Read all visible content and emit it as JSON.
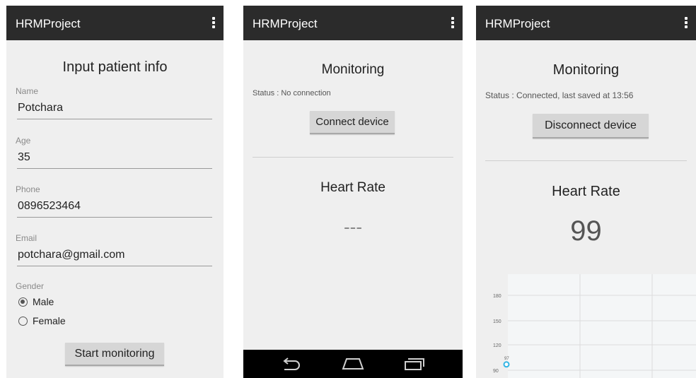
{
  "app": {
    "title": "HRMProject"
  },
  "screen1": {
    "heading": "Input patient info",
    "fields": [
      {
        "label": "Name",
        "value": "Potchara"
      },
      {
        "label": "Age",
        "value": "35"
      },
      {
        "label": "Phone",
        "value": "0896523464"
      },
      {
        "label": "Email",
        "value": "potchara@gmail.com"
      }
    ],
    "gender": {
      "label": "Gender",
      "options": [
        {
          "label": "Male",
          "selected": true
        },
        {
          "label": "Female",
          "selected": false
        }
      ]
    },
    "start_button": "Start monitoring"
  },
  "screen2": {
    "heading": "Monitoring",
    "status": "Status : No connection",
    "connect_button": "Connect device",
    "hr_heading": "Heart Rate",
    "hr_value": "---"
  },
  "screen3": {
    "heading": "Monitoring",
    "status": "Status : Connected, last saved at 13:56",
    "disconnect_button": "Disconnect device",
    "hr_heading": "Heart Rate",
    "hr_value": "99"
  },
  "chart_data": {
    "type": "line",
    "yticks": [
      "180",
      "150",
      "120",
      "90"
    ],
    "ylim": [
      85,
      190
    ],
    "grid": true,
    "series": [
      {
        "points": [
          {
            "x": 0,
            "y": 97,
            "label": "97"
          }
        ]
      }
    ],
    "colors": {
      "point": "#33b5e5",
      "grid": "#dcdcdc",
      "background": "#f4f6f7"
    }
  }
}
